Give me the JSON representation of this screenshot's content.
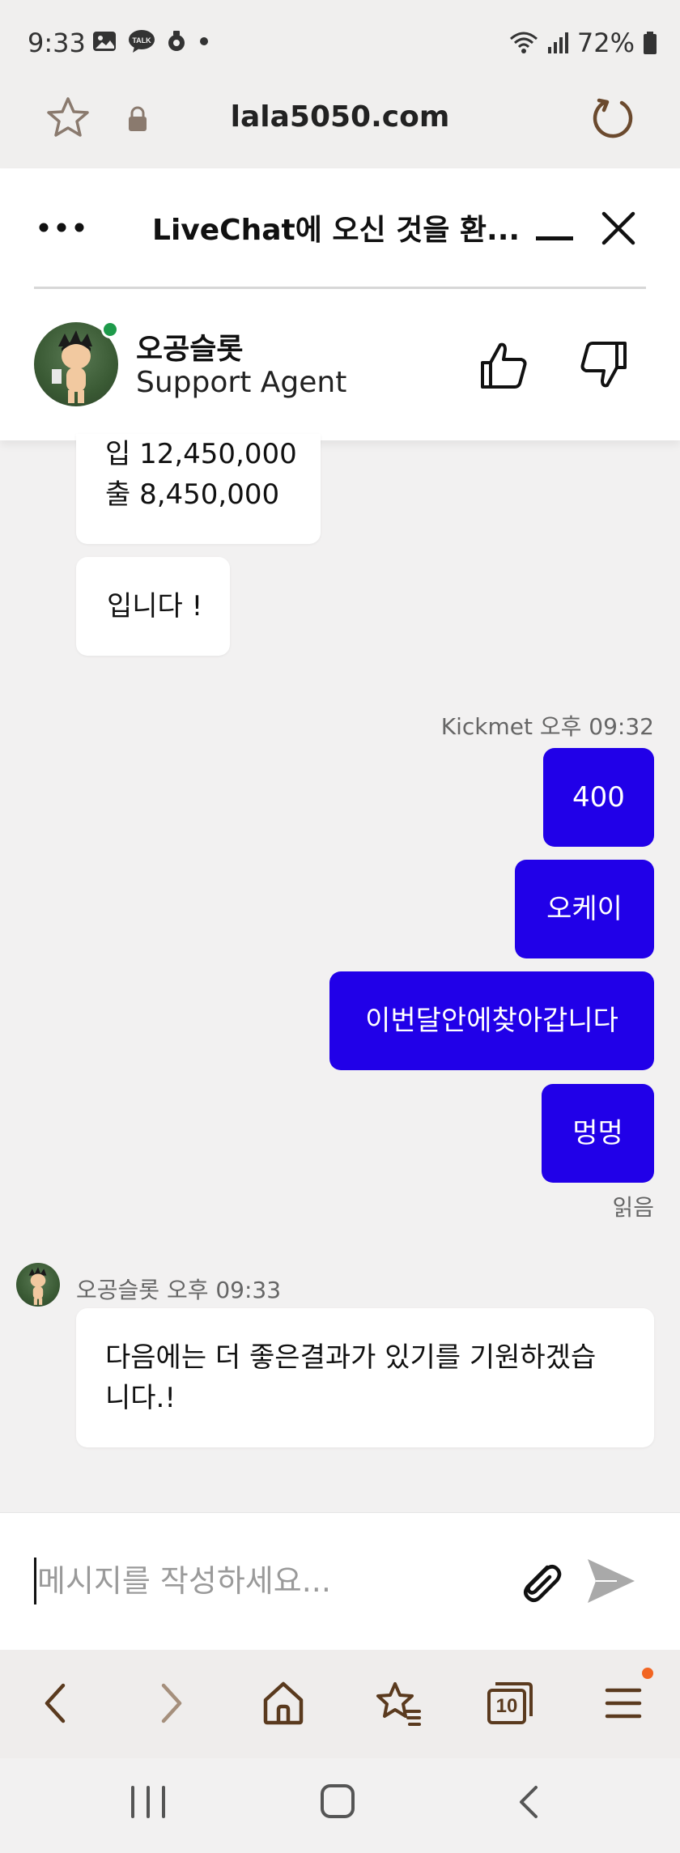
{
  "status_bar": {
    "time": "9:33",
    "battery": "72%",
    "icons_left": [
      "gallery-icon",
      "talk-icon",
      "vpn-icon",
      "dot-icon"
    ],
    "icons_right": [
      "wifi-icon",
      "signal-icon",
      "battery-icon"
    ]
  },
  "browser": {
    "url": "lala5050.com",
    "tabs_count": "10"
  },
  "chat": {
    "title": "LiveChat에 오신 것을 환...",
    "agent": {
      "name": "오공슬롯",
      "role": "Support Agent",
      "online_color": "#1e9a4a"
    },
    "messages": {
      "in1": {
        "line1": "입 12,450,000",
        "line2": "출 8,450,000"
      },
      "in2": {
        "text": "입니다 !"
      },
      "out_meta": "Kickmet 오후 09:32",
      "out1": "400",
      "out2": "오케이",
      "out3": "이번달안에찾아갑니다",
      "out4": "멍멍",
      "read_receipt": "읽음",
      "in3_meta": "오공슬롯 오후 09:33",
      "in3": {
        "line1": "다음에는 더 좋은결과가 있기를 기원하겠습",
        "line2": "니다.!"
      }
    },
    "composer": {
      "placeholder": "메시지를 작성하세요...",
      "value": ""
    }
  },
  "colors": {
    "outgoing_bubble": "#2100e8",
    "accent_brown": "#6b4a2e",
    "notification": "#f26522"
  }
}
